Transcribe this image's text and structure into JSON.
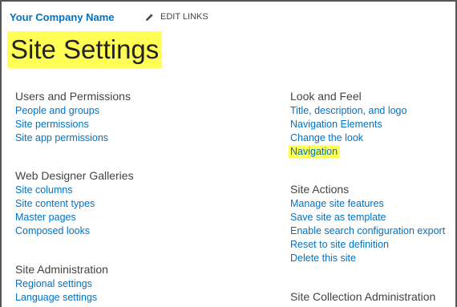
{
  "header": {
    "site_name": "Your Company Name",
    "edit_links": "EDIT LINKS",
    "page_title": "Site Settings"
  },
  "left_column": [
    {
      "title": "Users and Permissions",
      "links": [
        "People and groups",
        "Site permissions",
        "Site app permissions"
      ]
    },
    {
      "title": "Web Designer Galleries",
      "links": [
        "Site columns",
        "Site content types",
        "Master pages",
        "Composed looks"
      ]
    },
    {
      "title": "Site Administration",
      "links": [
        "Regional settings",
        "Language settings"
      ]
    }
  ],
  "right_column": [
    {
      "title": "Look and Feel",
      "links": [
        "Title, description, and logo",
        "Navigation Elements",
        "Change the look",
        "Navigation"
      ]
    },
    {
      "title": "Site Actions",
      "links": [
        "Manage site features",
        "Save site as template",
        "Enable search configuration export",
        "Reset to site definition",
        "Delete this site"
      ]
    },
    {
      "title": "Site Collection Administration",
      "links": []
    }
  ],
  "highlight_color": "#ffff55",
  "link_color": "#0072c6",
  "icons": {
    "edit": "pencil-icon"
  }
}
